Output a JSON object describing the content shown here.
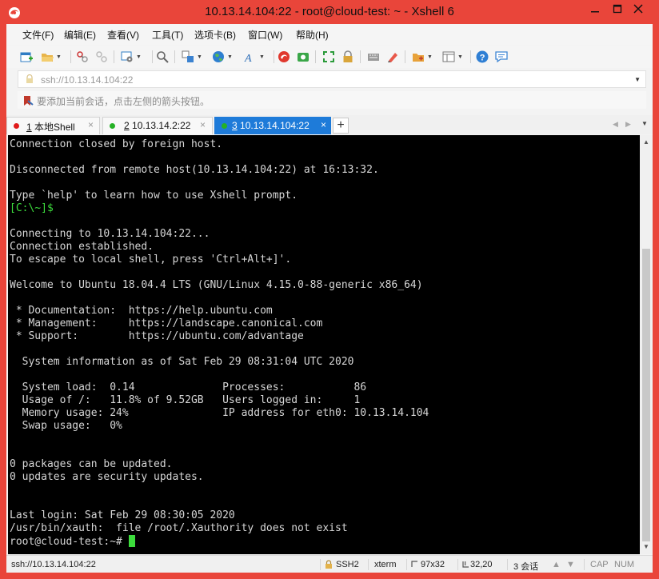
{
  "window": {
    "title": "10.13.14.104:22 - root@cloud-test: ~ - Xshell 6"
  },
  "menu": [
    "文件(F)",
    "编辑(E)",
    "查看(V)",
    "工具(T)",
    "选项卡(B)",
    "窗口(W)",
    "帮助(H)"
  ],
  "address": {
    "value": "ssh://10.13.14.104:22"
  },
  "hint": "要添加当前会话，点击左侧的箭头按钮。",
  "tabs": [
    {
      "num": "1",
      "label": "本地Shell",
      "status_color": "#e01a1a"
    },
    {
      "num": "2",
      "label": "10.13.14.2:22",
      "status_color": "#25b125"
    },
    {
      "num": "3",
      "label": "10.13.14.104:22",
      "status_color": "#25b125"
    }
  ],
  "terminal": {
    "block1": "Connection closed by foreign host.\n\nDisconnected from remote host(10.13.14.104:22) at 16:13:32.\n\nType `help' to learn how to use Xshell prompt.",
    "local_prompt": "[C:\\~]$",
    "block2": "\n\nConnecting to 10.13.14.104:22...\nConnection established.\nTo escape to local shell, press 'Ctrl+Alt+]'.\n\nWelcome to Ubuntu 18.04.4 LTS (GNU/Linux 4.15.0-88-generic x86_64)\n\n * Documentation:  https://help.ubuntu.com\n * Management:     https://landscape.canonical.com\n * Support:        https://ubuntu.com/advantage\n\n  System information as of Sat Feb 29 08:31:04 UTC 2020\n\n  System load:  0.14              Processes:           86\n  Usage of /:   11.8% of 9.52GB   Users logged in:     1\n  Memory usage: 24%               IP address for eth0: 10.13.14.104\n  Swap usage:   0%\n\n\n0 packages can be updated.\n0 updates are security updates.\n\n\nLast login: Sat Feb 29 08:30:05 2020\n/usr/bin/xauth:  file /root/.Xauthority does not exist\n",
    "remote_prompt": "root@cloud-test:~# "
  },
  "status": {
    "connection": "ssh://10.13.14.104:22",
    "protocol": "SSH2",
    "term": "xterm",
    "size": "97x32",
    "pos": "32,20",
    "sessions": "3 会话",
    "caps": "CAP",
    "num": "NUM"
  },
  "colors": {
    "titlebar": "#e9453a",
    "active_tab": "#1e7bd9",
    "prompt": "#3cdc3c"
  }
}
